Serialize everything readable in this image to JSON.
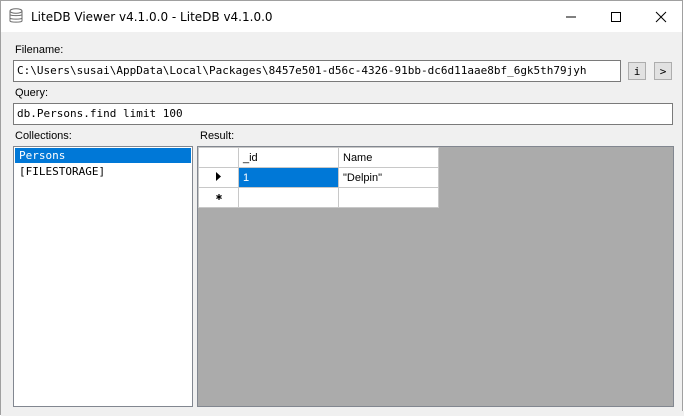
{
  "window": {
    "title": "LiteDB Viewer v4.1.0.0 - LiteDB v4.1.0.0"
  },
  "filename": {
    "label": "Filename:",
    "value": "C:\\Users\\susai\\AppData\\Local\\Packages\\8457e501-d56c-4326-91bb-dc6d11aae8bf_6gk5th79jyh",
    "info_button": "i",
    "go_button": ">"
  },
  "query": {
    "label": "Query:",
    "value": "db.Persons.find limit 100"
  },
  "collections": {
    "label": "Collections:",
    "items": [
      {
        "label": "Persons",
        "selected": true
      },
      {
        "label": "[FILESTORAGE]",
        "selected": false
      }
    ]
  },
  "result": {
    "label": "Result:",
    "columns": [
      "_id",
      "Name"
    ],
    "rows": [
      {
        "cells": [
          "1",
          "\"Delpin\""
        ]
      }
    ]
  }
}
